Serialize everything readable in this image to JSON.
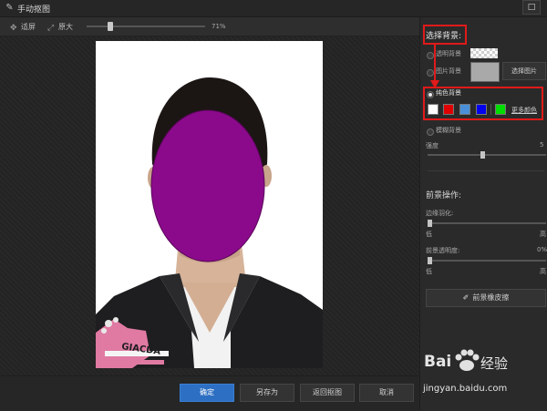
{
  "window": {
    "title": "手动抠图",
    "restore_glyph": "□",
    "close_glyph": "×"
  },
  "toolbar": {
    "fit_label": "适屏",
    "original_label": "原大",
    "zoom_value": "71%",
    "zoom_fraction": 0.18
  },
  "actions": {
    "confirm": "确定",
    "save_as": "另存为",
    "back": "返回抠图",
    "cancel": "取消"
  },
  "panel": {
    "section_title": "选择背景:",
    "bg_transparent": "透明背景",
    "bg_image": "图片背景",
    "choose_image": "选择图片",
    "bg_solid": "纯色背景",
    "more_colors": "更多颜色",
    "swatches": [
      "#ffffff",
      "#e00000",
      "#4a90d9",
      "#0000ee",
      "#00dd00"
    ],
    "bg_blur": "模糊背景",
    "strength_label": "强度",
    "strength_value": "5",
    "strength_fraction": 0.46,
    "foreground_title": "前景操作:",
    "feather_label": "边缘羽化:",
    "feather_low": "低",
    "feather_high": "高",
    "feather_fraction": 0.0,
    "opacity_label": "前景透明度:",
    "opacity_value": "0%",
    "opacity_low": "低",
    "opacity_high": "高",
    "opacity_fraction": 0.0,
    "eraser_button": "前景橡皮擦"
  },
  "photo": {
    "print_text": "GIACDA"
  },
  "watermark": {
    "brand_a": "Bai",
    "brand_b": "经验",
    "url": "jingyan.baidu.com"
  },
  "colors": {
    "accent": "#2d6fc2",
    "highlight": "#e01a1a",
    "face_mask": "#8b0a8b"
  }
}
